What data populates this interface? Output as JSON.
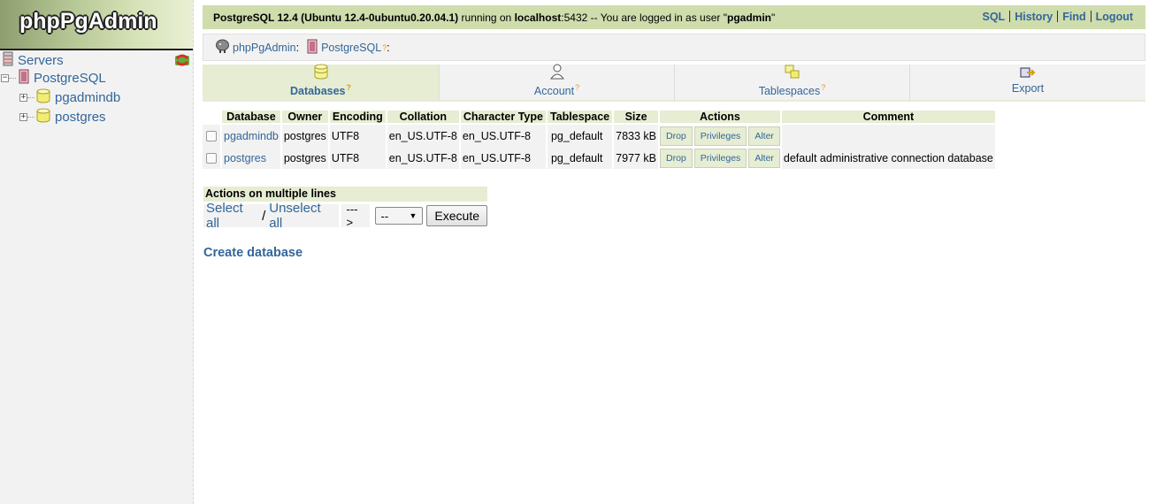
{
  "app": {
    "logo_text": "phpPgAdmin"
  },
  "sidebar": {
    "servers_label": "Servers",
    "server_label": "PostgreSQL",
    "databases": [
      {
        "label": "pgadmindb"
      },
      {
        "label": "postgres"
      }
    ]
  },
  "topbar": {
    "server_version": "PostgreSQL 12.4 (Ubuntu 12.4-0ubuntu0.20.04.1)",
    "running_on": " running on ",
    "host": "localhost",
    "port": ":5432",
    "logged_in_text": " -- You are logged in as user \"",
    "user": "pgadmin",
    "quote_end": "\"",
    "links": [
      "SQL",
      "History",
      "Find",
      "Logout"
    ]
  },
  "breadcrumb": {
    "root": "phpPgAdmin",
    "root_sep": ":",
    "server": "PostgreSQL",
    "server_help": "?",
    "server_sep": ":"
  },
  "tabs": [
    {
      "label": "Databases",
      "help": "?",
      "icon": "database-icon",
      "active": true
    },
    {
      "label": "Account",
      "help": "?",
      "icon": "user-icon",
      "active": false
    },
    {
      "label": "Tablespaces",
      "help": "?",
      "icon": "tablespace-icon",
      "active": false
    },
    {
      "label": "Export",
      "help": "",
      "icon": "export-icon",
      "active": false
    }
  ],
  "table": {
    "headers": [
      "Database",
      "Owner",
      "Encoding",
      "Collation",
      "Character Type",
      "Tablespace",
      "Size",
      "Actions",
      "Comment"
    ],
    "action_labels": [
      "Drop",
      "Privileges",
      "Alter"
    ],
    "rows": [
      {
        "database": "pgadmindb",
        "owner": "postgres",
        "encoding": "UTF8",
        "collation": "en_US.UTF-8",
        "ctype": "en_US.UTF-8",
        "tablespace": "pg_default",
        "size": "7833 kB",
        "comment": ""
      },
      {
        "database": "postgres",
        "owner": "postgres",
        "encoding": "UTF8",
        "collation": "en_US.UTF-8",
        "ctype": "en_US.UTF-8",
        "tablespace": "pg_default",
        "size": "7977 kB",
        "comment": "default administrative connection database"
      }
    ]
  },
  "multi_actions": {
    "header": "Actions on multiple lines",
    "select_all": "Select all",
    "slash": "/",
    "unselect_all": "Unselect all",
    "arrow": "--->",
    "select_value": "--",
    "execute_label": "Execute"
  },
  "create_database_link": "Create database",
  "colors": {
    "header_green": "#cfdcac",
    "light_green": "#e6edd2",
    "link_blue": "#336699",
    "help_orange": "#e89a1d"
  }
}
